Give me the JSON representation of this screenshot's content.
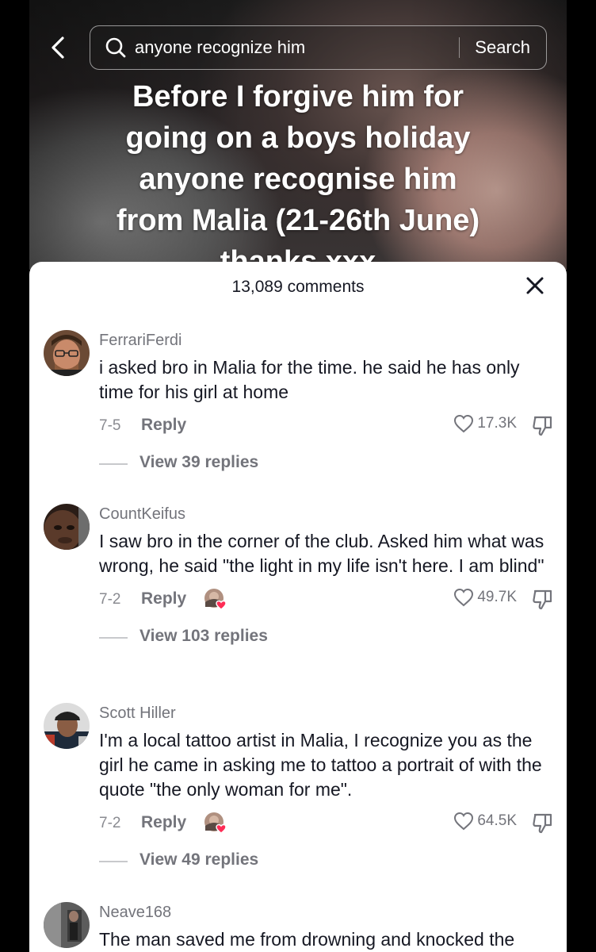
{
  "search": {
    "query": "anyone recognize him",
    "button_label": "Search"
  },
  "video": {
    "overlay_lines": [
      "Before I forgive him for",
      "going on a boys holiday",
      "anyone recognise him",
      "from Malia (21-26th June)",
      "thanks xxx"
    ]
  },
  "comments_sheet": {
    "title": "13,089 comments",
    "comments": [
      {
        "username": "FerrariFerdi",
        "text": "i asked bro in Malia for the time. he said he has only time for his girl at home",
        "date": "7-5",
        "reply_label": "Reply",
        "likes": "17.3K",
        "replies_label": "View 39 replies",
        "creator_liked": false,
        "avatar_icon": "avatar-man-glasses"
      },
      {
        "username": "CountKeifus",
        "text": "I saw bro in the corner of the club. Asked him what was wrong, he said \"the light in my life isn't here. I am blind\"",
        "date": "7-2",
        "reply_label": "Reply",
        "likes": "49.7K",
        "replies_label": "View 103 replies",
        "creator_liked": true,
        "avatar_icon": "avatar-man-closeup"
      },
      {
        "username": "Scott Hiller",
        "text": "I'm a local tattoo artist in Malia, I recognize you as the girl he came in asking me to tattoo a portrait of with the quote \"the only woman for me\".",
        "date": "7-2",
        "reply_label": "Reply",
        "likes": "64.5K",
        "replies_label": "View 49 replies",
        "creator_liked": true,
        "avatar_icon": "avatar-man-hat"
      },
      {
        "username": "Neave168",
        "text": "The man saved me from drowning and knocked the",
        "avatar_icon": "avatar-woman-mirror"
      }
    ]
  },
  "colors": {
    "accent_heart": "#fe2c55",
    "text_primary": "#161823",
    "text_secondary": "#73747b"
  }
}
